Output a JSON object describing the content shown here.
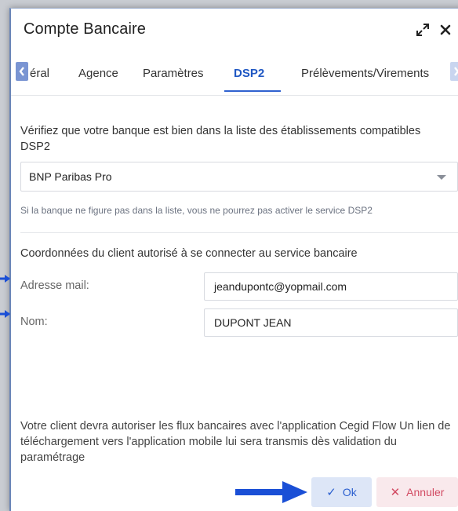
{
  "dialog": {
    "title": "Compte Bancaire"
  },
  "tabs": [
    {
      "label": "éral"
    },
    {
      "label": "Agence"
    },
    {
      "label": "Paramètres"
    },
    {
      "label": "DSP2",
      "active": true
    },
    {
      "label": "Prélèvements/Virements"
    }
  ],
  "content": {
    "intro": "Vérifiez que votre banque est bien dans la liste des établissements compatibles DSP2",
    "bank_select": {
      "value": "BNP Paribas Pro"
    },
    "hint": "Si la banque ne figure pas dans la liste, vous ne pourrez pas activer le service DSP2",
    "section_title": "Coordonnées du client autorisé à se connecter au service bancaire",
    "email": {
      "label": "Adresse mail:",
      "value": "jeandupontc@yopmail.com"
    },
    "name": {
      "label": "Nom:",
      "value": "DUPONT JEAN"
    },
    "footer": "Votre client devra autoriser les flux bancaires avec l'application Cegid Flow Un lien de téléchargement vers l'application mobile lui sera transmis dès validation du paramétrage"
  },
  "buttons": {
    "ok": "Ok",
    "cancel": "Annuler"
  },
  "colors": {
    "accent": "#2f62d0",
    "annotation_arrow": "#1a4fd6",
    "cancel": "#d24b63"
  },
  "icons": {
    "expand": "expand-icon",
    "close": "close-icon",
    "tab_left": "chevron-left-icon",
    "tab_right": "chevron-right-icon",
    "dropdown": "caret-down-icon",
    "ok": "check-icon",
    "cancel": "x-icon"
  }
}
